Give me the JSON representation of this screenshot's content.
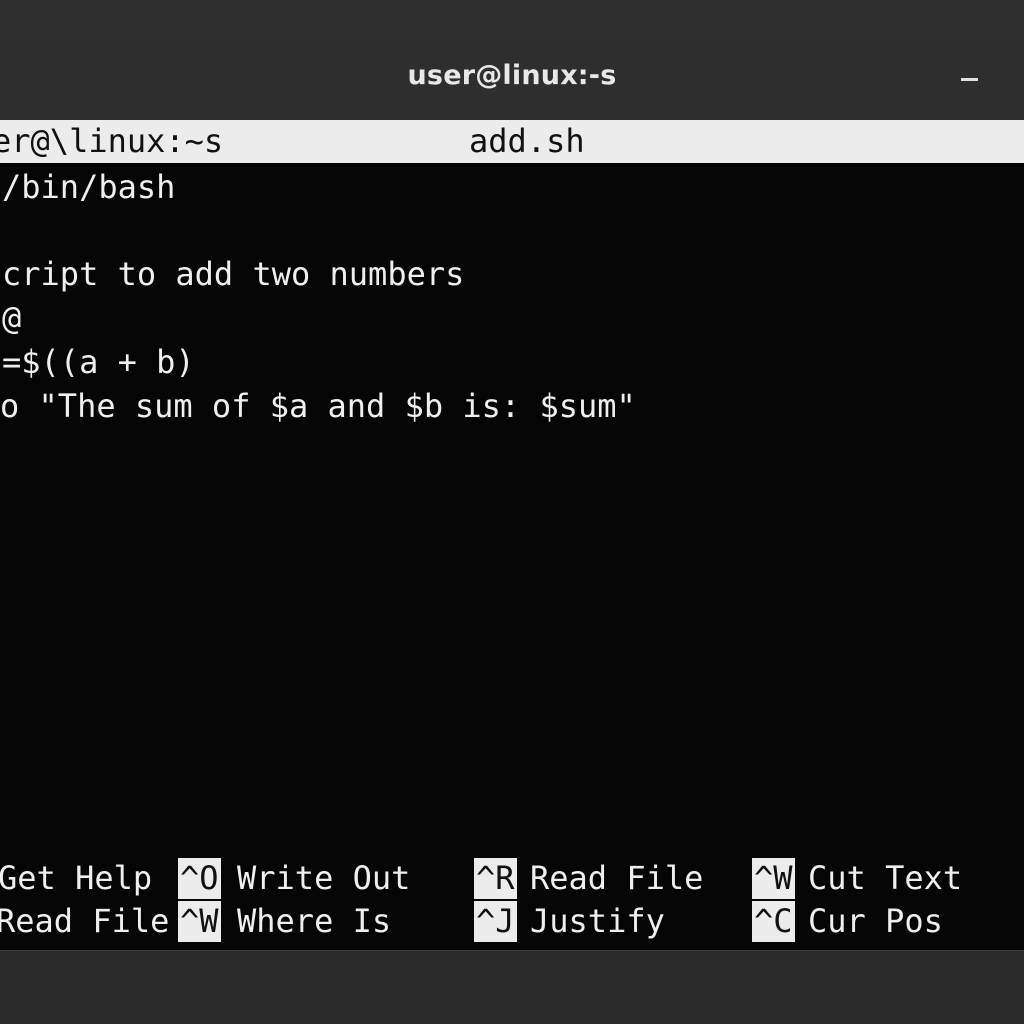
{
  "window": {
    "title": "user@linux:-s"
  },
  "nano_header": {
    "left_text": "er@\\linux:~s",
    "file_name": "add.sh"
  },
  "editor": {
    "lines": [
      "/bin/bash",
      "",
      "cript to add two numbers",
      "@",
      "=$((a + b)",
      "o \"The sum of $a and $b is: $sum\""
    ]
  },
  "shortcuts": {
    "row1": [
      {
        "key": "",
        "label": "Get Help"
      },
      {
        "key": "^O",
        "label": "Write Out"
      },
      {
        "key": "^R",
        "label": "Read File"
      },
      {
        "key": "^W",
        "label": "Cut Text"
      }
    ],
    "row2": [
      {
        "key": "",
        "label": "Read File"
      },
      {
        "key": "^W",
        "label": "Where Is"
      },
      {
        "key": "^J",
        "label": "Justify"
      },
      {
        "key": "^C",
        "label": "Cur Pos"
      }
    ]
  },
  "colors": {
    "titlebar": "#2e2e2e",
    "terminal_bg": "#050505",
    "header_bar": "#ececec",
    "text": "#efefef"
  }
}
